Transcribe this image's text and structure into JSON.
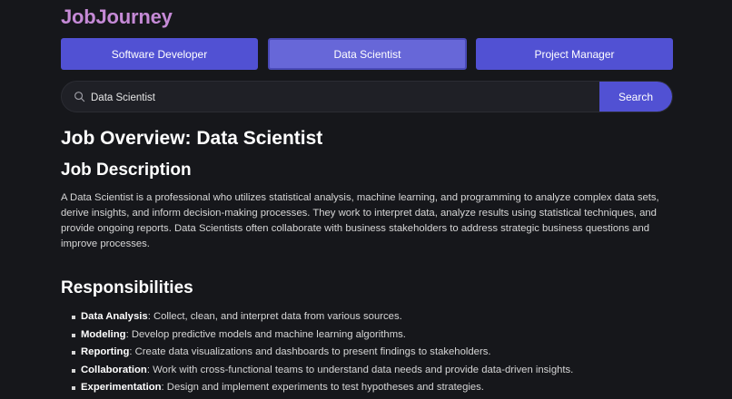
{
  "app": {
    "logo": "JobJourney"
  },
  "roles": [
    {
      "label": "Software Developer",
      "active": false
    },
    {
      "label": "Data Scientist",
      "active": true
    },
    {
      "label": "Project Manager",
      "active": false
    }
  ],
  "search": {
    "value": "Data Scientist",
    "button_label": "Search",
    "icon": "search-icon"
  },
  "overview": {
    "title": "Job Overview: Data Scientist"
  },
  "description": {
    "title": "Job Description",
    "text": "A Data Scientist is a professional who utilizes statistical analysis, machine learning, and programming to analyze complex data sets, derive insights, and inform decision-making processes. They work to interpret data, analyze results using statistical techniques, and provide ongoing reports. Data Scientists often collaborate with business stakeholders to address strategic business questions and improve processes."
  },
  "responsibilities": {
    "title": "Responsibilities",
    "items": [
      {
        "term": "Data Analysis",
        "text": ": Collect, clean, and interpret data from various sources."
      },
      {
        "term": "Modeling",
        "text": ": Develop predictive models and machine learning algorithms."
      },
      {
        "term": "Reporting",
        "text": ": Create data visualizations and dashboards to present findings to stakeholders."
      },
      {
        "term": "Collaboration",
        "text": ": Work with cross-functional teams to understand data needs and provide data-driven insights."
      },
      {
        "term": "Experimentation",
        "text": ": Design and implement experiments to test hypotheses and strategies."
      }
    ]
  },
  "colors": {
    "accent": "#5151d3",
    "logo": "#c58ad6",
    "background": "#16171b"
  }
}
